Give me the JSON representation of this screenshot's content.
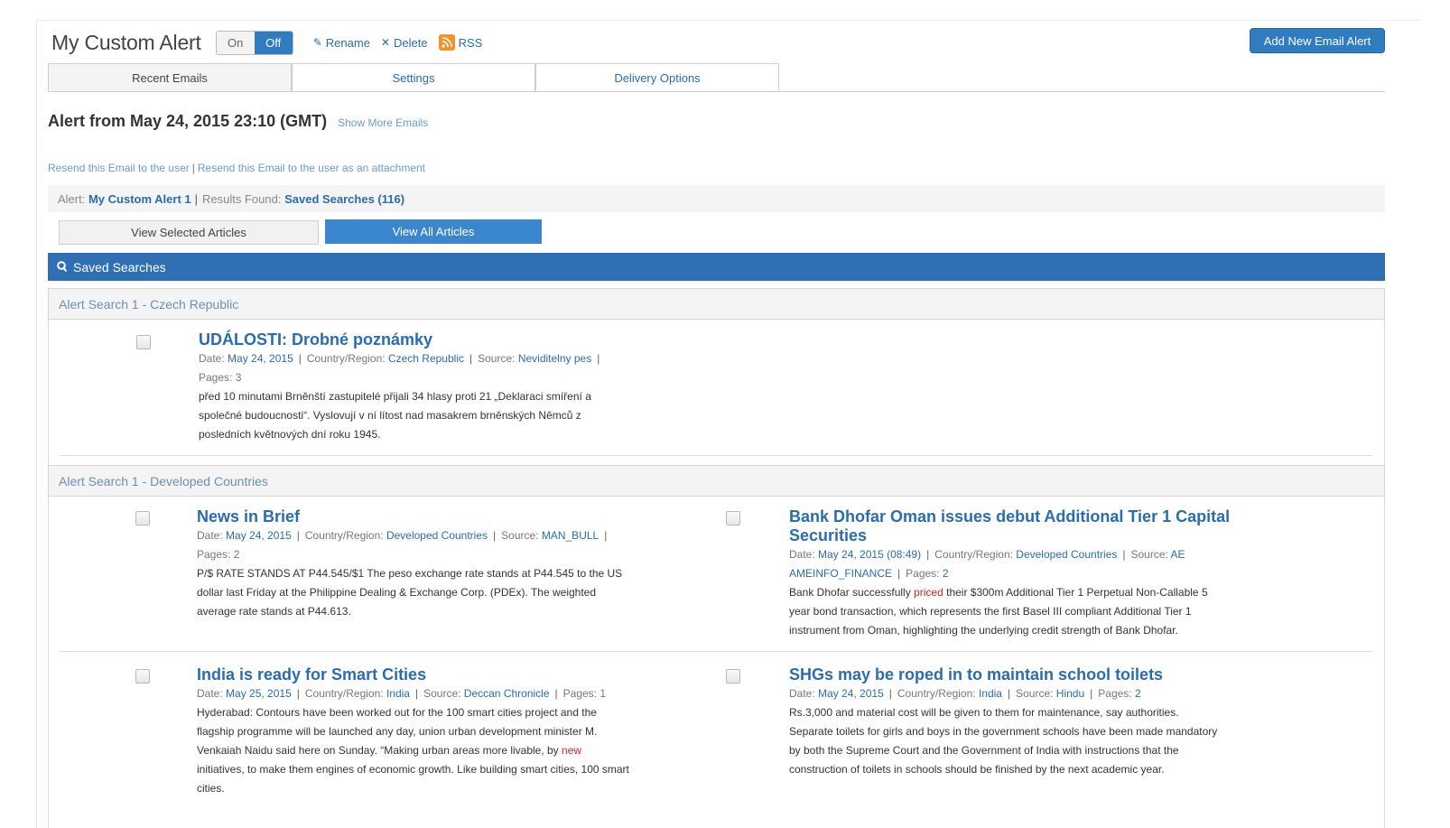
{
  "header": {
    "title": "My Custom Alert",
    "toggle_on": "On",
    "toggle_off": "Off",
    "rename": "Rename",
    "delete": "Delete",
    "rss": "RSS",
    "add_button": "Add New Email Alert"
  },
  "tabs": [
    {
      "label": "Recent Emails"
    },
    {
      "label": "Settings"
    },
    {
      "label": "Delivery Options"
    }
  ],
  "alert": {
    "heading": "Alert from May 24, 2015 23:10 (GMT)",
    "show_more": "Show More Emails",
    "resend_user": "Resend this Email to the user",
    "resend_attachment": "Resend this Email to the user as an attachment",
    "alert_label": "Alert:",
    "alert_name": "My Custom Alert 1",
    "results_label": "Results Found:",
    "results_value": "Saved Searches (116)"
  },
  "buttons": {
    "view_selected": "View Selected Articles",
    "view_all": "View All Articles"
  },
  "saved_bar": {
    "label": "Saved Searches"
  },
  "sections": [
    {
      "title": "Alert Search 1 - Czech Republic",
      "articles": [
        {
          "title": "UDÁLOSTI: Drobné poznámky",
          "date_label": "Date:",
          "date": "May 24, 2015",
          "country_label": "Country/Region:",
          "country": "Czech Republic",
          "source_label": "Source:",
          "source": "Neviditelny pes",
          "pages_label": "Pages:",
          "pages": "3",
          "body_1": "před 10 minutami Brněnští zastupitelé přijali 34 hlasy proti 21 „Deklaraci smíření a",
          "body_2": "společné budoucnosti“. Vyslovují v ní lítost nad masakrem brněnských Němců z",
          "body_3": "posledních květnových dní roku 1945."
        }
      ]
    },
    {
      "title": "Alert Search 1 - Developed Countries",
      "articles": [
        {
          "title": "News in Brief",
          "date_label": "Date:",
          "date": "May 24, 2015",
          "country_label": "Country/Region:",
          "country": "Developed Countries",
          "source_label": "Source:",
          "source": "MAN_BULL",
          "pages_label": "Pages:",
          "pages": "2",
          "body_1": "P/$ RATE STANDS AT P44.545/$1 The peso exchange rate stands at P44.545 to the US",
          "body_2": "dollar last Friday at the Philippine Dealing & Exchange Corp. (PDEx). The weighted",
          "body_3": "average rate stands at P44.613."
        },
        {
          "title_1": "Bank Dhofar Oman issues debut Additional Tier 1 Capital",
          "title_2": "Securities",
          "date_label": "Date:",
          "date": "May 24, 2015 (08:49)",
          "country_label": "Country/Region:",
          "country": "Developed Countries",
          "source_label": "Source:",
          "source_1": "AE",
          "source_2": "AMEINFO_FINANCE",
          "pages_label": "Pages:",
          "pages": "2",
          "body_1a": "Bank Dhofar successfully",
          "body_1red": "priced",
          "body_1b": "their $300m Additional Tier 1 Perpetual Non-Callable 5",
          "body_2": "year bond transaction, which represents the first Basel III compliant Additional Tier 1",
          "body_3": "instrument from Oman, highlighting the underlying credit strength of Bank Dhofar."
        },
        {
          "title": "India is ready for Smart Cities",
          "date_label": "Date:",
          "date": "May 25, 2015",
          "country_label": "Country/Region:",
          "country": "India",
          "source_label": "Source:",
          "source": "Deccan Chronicle",
          "pages_label": "Pages:",
          "pages": "1",
          "body_1": "Hyderabad: Contours have been worked out for the 100 smart cities project and the",
          "body_2": "flagship programme will be launched any day, union urban development minister M.",
          "body_3a": "Venkaiah Naidu said here on Sunday. “Making urban areas more livable, by",
          "body_3red": "new",
          "body_4": "initiatives, to make them engines of economic growth. Like building smart cities, 100 smart",
          "body_5": "cities."
        },
        {
          "title": "SHGs may be roped in to maintain school toilets",
          "date_label": "Date:",
          "date": "May 24, 2015",
          "country_label": "Country/Region:",
          "country": "India",
          "source_label": "Source:",
          "source": "Hindu",
          "pages_label": "Pages:",
          "pages": "2",
          "body_1": "Rs.3,000 and material cost will be given to them for maintenance, say authorities.",
          "body_2": "Separate toilets for girls and boys in the government schools have been made mandatory",
          "body_3": "by both the Supreme Court and the Government of India with instructions that the",
          "body_4": "construction of toilets in schools should be finished by the next academic year."
        }
      ]
    }
  ],
  "icons": {
    "rename": "pencil-icon",
    "delete": "x-icon",
    "rss": "rss-icon",
    "search": "search-icon"
  },
  "colors": {
    "accent": "#2f7cc1",
    "saved_bar": "#2f6fb4",
    "link": "#2a6cb0",
    "highlight": "#dd2222"
  }
}
